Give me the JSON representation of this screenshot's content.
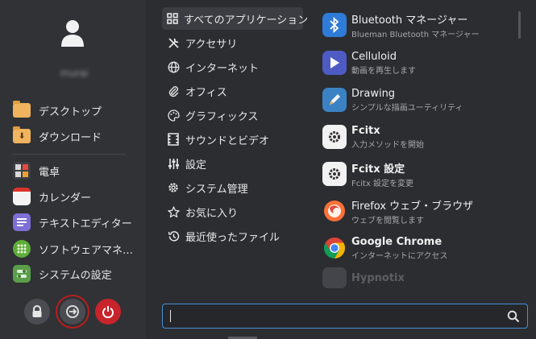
{
  "user": {
    "name": "murai"
  },
  "places": [
    {
      "label": "デスクトップ",
      "icon": "folder-icon"
    },
    {
      "label": "ダウンロード",
      "icon": "download-folder-icon"
    }
  ],
  "favorites": [
    {
      "label": "電卓",
      "icon": "calculator-icon"
    },
    {
      "label": "カレンダー",
      "icon": "calendar-icon"
    },
    {
      "label": "テキストエディター",
      "icon": "text-editor-icon"
    },
    {
      "label": "ソフトウェアマネ…",
      "icon": "software-manager-icon"
    },
    {
      "label": "システムの設定",
      "icon": "system-settings-icon"
    }
  ],
  "session_buttons": {
    "lock": "lock-icon",
    "logout": "logout-icon",
    "power": "power-icon"
  },
  "categories": [
    {
      "label": "すべてのアプリケーション",
      "icon": "grid-icon",
      "active": true
    },
    {
      "label": "アクセサリ",
      "icon": "tools-icon"
    },
    {
      "label": "インターネット",
      "icon": "globe-icon"
    },
    {
      "label": "オフィス",
      "icon": "paperclip-icon"
    },
    {
      "label": "グラフィックス",
      "icon": "palette-icon"
    },
    {
      "label": "サウンドとビデオ",
      "icon": "film-icon"
    },
    {
      "label": "設定",
      "icon": "sliders-icon"
    },
    {
      "label": "システム管理",
      "icon": "gear-icon"
    },
    {
      "label": "お気に入り",
      "icon": "star-icon"
    },
    {
      "label": "最近使ったファイル",
      "icon": "history-icon"
    }
  ],
  "apps": [
    {
      "name": "Bluetooth マネージャー",
      "desc": "Blueman Bluetooth マネージャー",
      "icon": "bluetooth-icon"
    },
    {
      "name": "Celluloid",
      "desc": "動画を再生します",
      "icon": "celluloid-icon"
    },
    {
      "name": "Drawing",
      "desc": "シンプルな描画ユーティリティ",
      "icon": "drawing-icon"
    },
    {
      "name": "Fcitx",
      "desc": "入力メソッドを開始",
      "icon": "fcitx-icon"
    },
    {
      "name": "Fcitx 設定",
      "desc": "Fcitx 設定を変更",
      "icon": "fcitx-config-icon"
    },
    {
      "name": "Firefox ウェブ・ブラウザ",
      "desc": "ウェブを閲覧します",
      "icon": "firefox-icon"
    },
    {
      "name": "Google Chrome",
      "desc": "インターネットにアクセス",
      "icon": "chrome-icon"
    },
    {
      "name": "Hypnotix",
      "desc": "",
      "icon": "hypnotix-icon"
    }
  ],
  "search": {
    "value": "",
    "placeholder": ""
  },
  "colors": {
    "accent": "#4a8fd6",
    "power": "#c8242b",
    "folder": "#f0b35e"
  }
}
